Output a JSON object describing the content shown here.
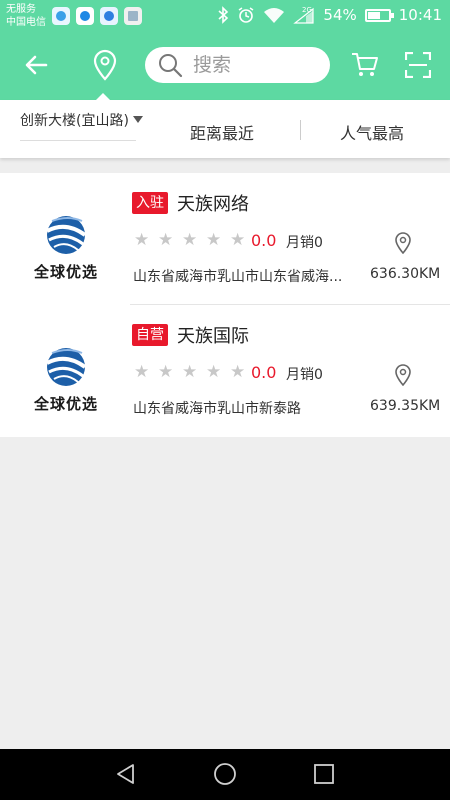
{
  "status_bar": {
    "carrier_line1": "无服务",
    "carrier_line2": "中国电信",
    "network": "2G",
    "battery": "54%",
    "battery_level": 0.54,
    "time": "10:41",
    "icons": [
      "bluetooth-icon",
      "alarm-icon",
      "wifi-icon",
      "signal-icon",
      "battery-icon"
    ]
  },
  "header": {
    "search_placeholder": "搜索",
    "icons": [
      "back-arrow-icon",
      "location-pin-icon",
      "search-icon",
      "cart-icon",
      "scan-icon"
    ]
  },
  "filter": {
    "location": "创新大楼(宜山路)",
    "sort_distance": "距离最近",
    "sort_popularity": "人气最高"
  },
  "stores": [
    {
      "tag": "入驻",
      "name": "天族网络",
      "logo_text": "全球优选",
      "rating": "0.0",
      "stars": 0,
      "monthly_sales": "月销0",
      "address": "山东省威海市乳山市山东省威海...",
      "distance": "636.30KM"
    },
    {
      "tag": "自营",
      "name": "天族国际",
      "logo_text": "全球优选",
      "rating": "0.0",
      "stars": 0,
      "monthly_sales": "月销0",
      "address": "山东省威海市乳山市新泰路",
      "distance": "639.35KM"
    }
  ],
  "colors": {
    "primary": "#5dd9a2",
    "tag_red": "#e8192c",
    "star_empty": "#c8c8c8"
  }
}
